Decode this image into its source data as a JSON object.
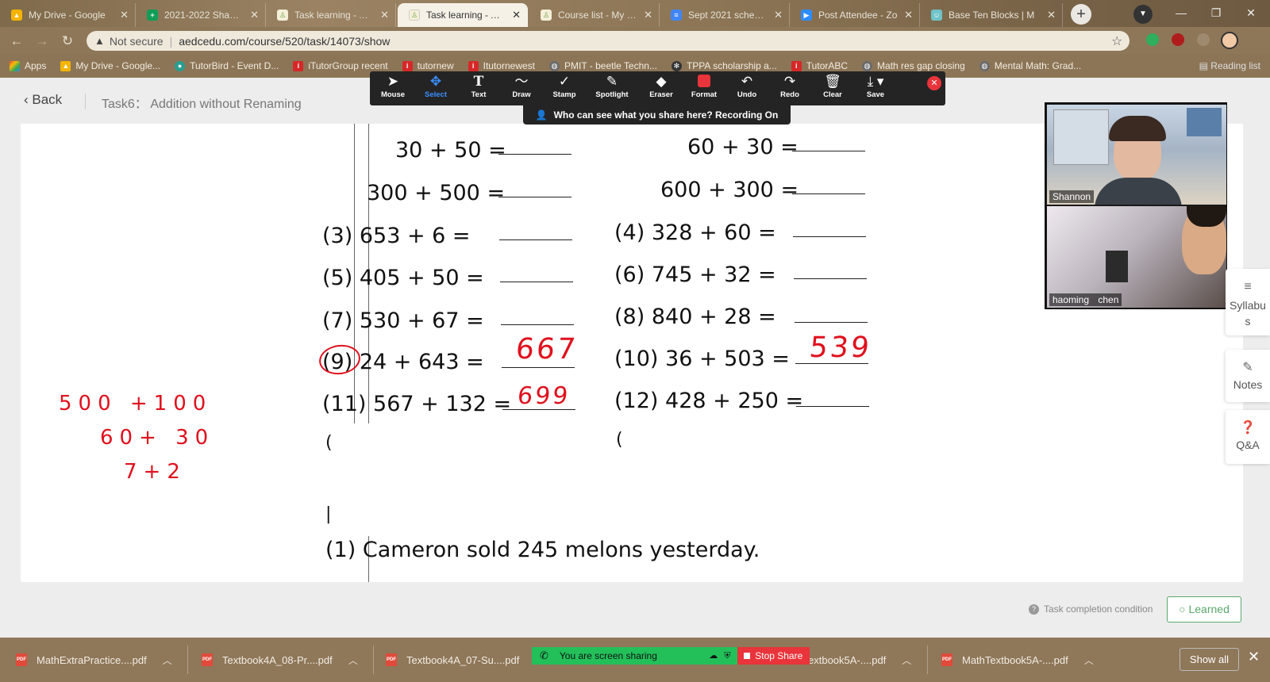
{
  "browser": {
    "tabs": [
      {
        "title": "My Drive - Google",
        "icon": "drive-icon",
        "active": false
      },
      {
        "title": "2021-2022 Shannon",
        "icon": "sheets-icon",
        "active": false
      },
      {
        "title": "Task learning - Aca",
        "icon": "aedc-icon",
        "active": false
      },
      {
        "title": "Task learning - Aca",
        "icon": "aedc-icon",
        "active": true
      },
      {
        "title": "Course list - My tea",
        "icon": "aedc-icon",
        "active": false
      },
      {
        "title": "Sept 2021 schedule",
        "icon": "docs-icon",
        "active": false
      },
      {
        "title": "Post Attendee - Zo",
        "icon": "zoom-icon",
        "active": false
      },
      {
        "title": "Base Ten Blocks | M",
        "icon": "mathlearning-icon",
        "active": false
      }
    ],
    "new_tab": "+",
    "address": {
      "security": "Not secure",
      "url": "aedcedu.com/course/520/task/14073/show"
    },
    "bookmarks": [
      {
        "label": "Apps",
        "icon": "apps-grid-icon"
      },
      {
        "label": "My Drive - Google...",
        "icon": "drive-icon"
      },
      {
        "label": "TutorBird - Event D...",
        "icon": "tutorbird-icon"
      },
      {
        "label": "iTutorGroup recent",
        "icon": "itutor-icon"
      },
      {
        "label": "tutornew",
        "icon": "itutor-icon"
      },
      {
        "label": "Itutornewest",
        "icon": "itutor-icon"
      },
      {
        "label": "PMIT - beetle Techn...",
        "icon": "globe-icon"
      },
      {
        "label": "TPPA scholarship a...",
        "icon": "tppa-icon"
      },
      {
        "label": "TutorABC",
        "icon": "itutor-icon"
      },
      {
        "label": "Math res gap closing",
        "icon": "globe-icon"
      },
      {
        "label": "Mental Math: Grad...",
        "icon": "globe-icon"
      }
    ],
    "reading_list": "Reading list"
  },
  "page": {
    "back_label": "Back",
    "task_title": "Task6： Addition without Renaming"
  },
  "worksheet": {
    "rows": [
      {
        "left": {
          "num": "",
          "expr": "30  +  50    ="
        },
        "right": {
          "num": "",
          "expr": "60  +  30    ="
        }
      },
      {
        "left": {
          "num": "",
          "expr": "300 + 500 ="
        },
        "right": {
          "num": "",
          "expr": "600  + 300 ="
        }
      },
      {
        "left": {
          "num": "(3)",
          "expr": "653 + 6      ="
        },
        "right": {
          "num": "(4)",
          "expr": "328  + 60    ="
        }
      },
      {
        "left": {
          "num": "(5)",
          "expr": "405 + 50    ="
        },
        "right": {
          "num": "(6)",
          "expr": "745  + 32    ="
        }
      },
      {
        "left": {
          "num": "(7)",
          "expr": "530 + 67    ="
        },
        "right": {
          "num": "(8)",
          "expr": "840  + 28    ="
        }
      },
      {
        "left": {
          "num": "(9)",
          "expr": "24  + 643 ="
        },
        "right": {
          "num": "(10)",
          "expr": "36  + 503 ="
        }
      },
      {
        "left": {
          "num": "(11)",
          "expr": "567 + 132 ="
        },
        "right": {
          "num": "(12)",
          "expr": "428  + 250 ="
        }
      }
    ],
    "word_problem": {
      "num": "(1)",
      "text": "Cameron sold 245 melons yesterday."
    },
    "answers": {
      "q9": "667",
      "q10": "539",
      "q11": "699"
    },
    "scratch": [
      "500 +100",
      "60+ 30",
      "7+2"
    ]
  },
  "annotation_toolbar": {
    "tools": [
      {
        "label": "Mouse",
        "icon": "mouse-pointer-icon"
      },
      {
        "label": "Select",
        "icon": "select-move-icon",
        "selected": true
      },
      {
        "label": "Text",
        "icon": "text-icon"
      },
      {
        "label": "Draw",
        "icon": "draw-squiggle-icon"
      },
      {
        "label": "Stamp",
        "icon": "stamp-check-icon"
      },
      {
        "label": "Spotlight",
        "icon": "spotlight-wand-icon"
      },
      {
        "label": "Eraser",
        "icon": "eraser-icon"
      },
      {
        "label": "Format",
        "icon": "format-color-icon"
      },
      {
        "label": "Undo",
        "icon": "undo-icon"
      },
      {
        "label": "Redo",
        "icon": "redo-icon"
      },
      {
        "label": "Clear",
        "icon": "trash-icon"
      },
      {
        "label": "Save",
        "icon": "save-download-icon"
      }
    ],
    "caption": "Who can see what you share here? Recording On",
    "format_color": "#e8343a",
    "select_color": "#3a8fff"
  },
  "video": {
    "participants": [
      {
        "name": "Shannon"
      },
      {
        "name": "haoming chen"
      }
    ]
  },
  "side_tabs": [
    {
      "label": "Syllabus",
      "icon": "list-icon"
    },
    {
      "label": "Notes",
      "icon": "pencil-icon"
    },
    {
      "label": "Q&A",
      "icon": "question-icon"
    }
  ],
  "footer": {
    "task_condition": "Task completion condition",
    "learned_label": "Learned",
    "learned_color": "#5aa86b"
  },
  "downloads": {
    "files": [
      "MathExtraPractice....pdf",
      "Textbook4A_08-Pr....pdf",
      "Textbook4A_07-Su....pdf",
      "extbook5A-....pdf",
      "MathTextbook5A-....pdf"
    ],
    "show_all": "Show all"
  },
  "screen_share": {
    "message": "You are screen sharing",
    "stop_label": "Stop Share"
  }
}
